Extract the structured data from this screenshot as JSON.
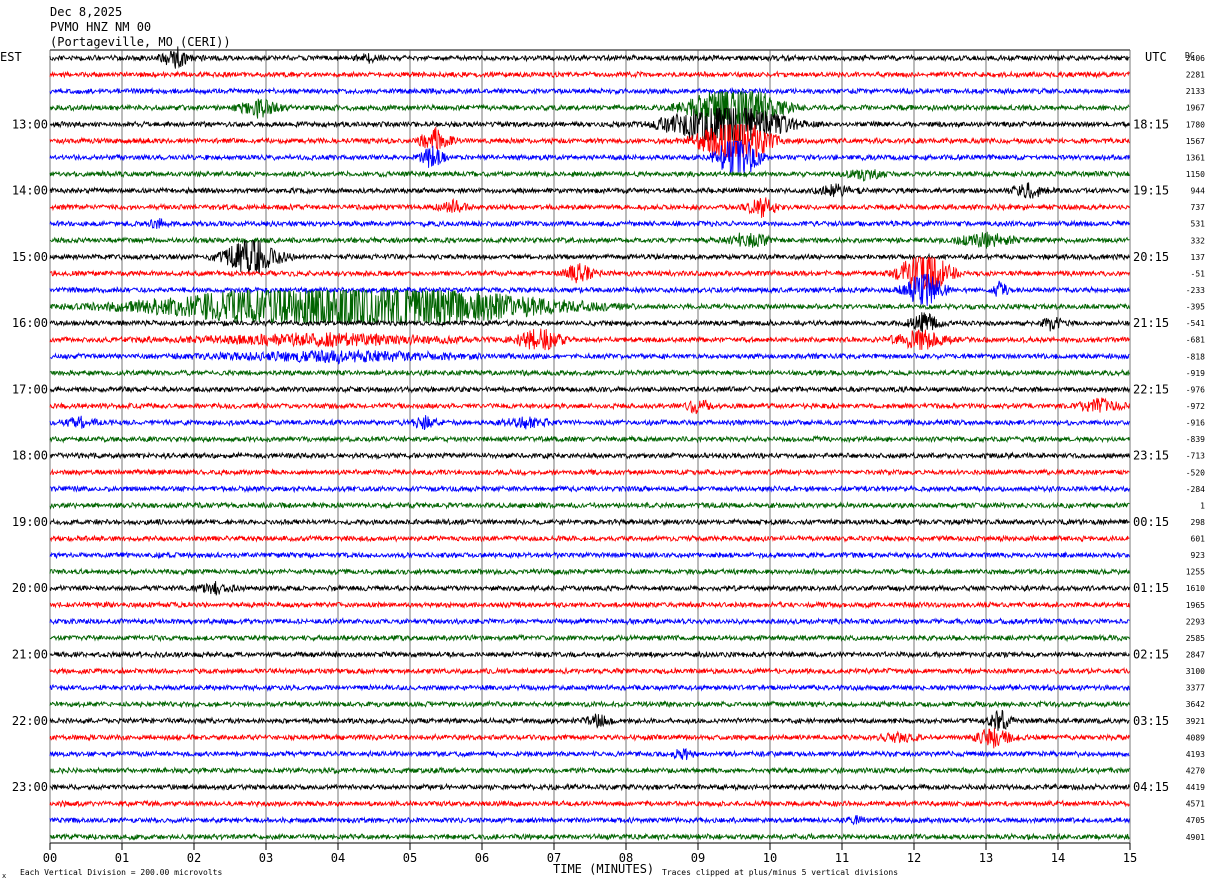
{
  "header": {
    "date": "Dec 8,2025",
    "station": "PVMO HNZ NM 00",
    "location": "(Portageville, MO (CERI))"
  },
  "labels": {
    "left_tz": "EST",
    "right_tz": "UTC",
    "dc": "DC",
    "x_axis": "TIME (MINUTES)",
    "scale_note": "Each Vertical Division =  200.00 microvolts",
    "clip_note": "Traces clipped at plus/minus 5 vertical divisions",
    "corner_mark": "x"
  },
  "chart_data": {
    "type": "line",
    "title": "PVMO HNZ NM 00",
    "xlabel": "TIME (MINUTES)",
    "xlim": [
      0,
      15
    ],
    "x_ticks": [
      "00",
      "01",
      "02",
      "03",
      "04",
      "05",
      "06",
      "07",
      "08",
      "09",
      "10",
      "11",
      "12",
      "13",
      "14",
      "15"
    ],
    "trace_count": 48,
    "trace_minutes": 15,
    "trace_colors": [
      "#000000",
      "#ff0000",
      "#0000ff",
      "#006400"
    ],
    "grid": "vertical lines each minute",
    "left_hour_labels": [
      "13:00",
      "14:00",
      "15:00",
      "16:00",
      "17:00",
      "18:00",
      "19:00",
      "20:00",
      "21:00",
      "22:00",
      "23:00"
    ],
    "right_hour_labels": [
      "18:15",
      "19:15",
      "20:15",
      "21:15",
      "22:15",
      "23:15",
      "00:15",
      "01:15",
      "02:15",
      "03:15",
      "04:15"
    ],
    "dc_offsets": [
      "2406",
      "2281",
      "2133",
      "1967",
      "1780",
      "1567",
      "1361",
      "1150",
      "944",
      "737",
      "531",
      "332",
      "137",
      "-51",
      "-233",
      "-395",
      "-541",
      "-681",
      "-818",
      "-919",
      "-976",
      "-972",
      "-916",
      "-839",
      "-713",
      "-520",
      "-284",
      "1",
      "298",
      "601",
      "923",
      "1255",
      "1610",
      "1965",
      "2293",
      "2585",
      "2847",
      "3100",
      "3377",
      "3642",
      "3921",
      "4089",
      "4193",
      "4270",
      "4419",
      "4571",
      "4705",
      "4901"
    ],
    "events": [
      {
        "trace": 0,
        "minute": 1.75,
        "amp": 1.6,
        "dur": 0.35
      },
      {
        "trace": 0,
        "minute": 4.4,
        "amp": 0.6,
        "dur": 0.25
      },
      {
        "trace": 3,
        "minute": 2.9,
        "amp": 1.4,
        "dur": 0.5
      },
      {
        "trace": 4,
        "minute": 9.4,
        "amp": 5,
        "dur": 1.4
      },
      {
        "trace": 3,
        "minute": 9.5,
        "amp": 5,
        "dur": 1.1
      },
      {
        "trace": 5,
        "minute": 9.5,
        "amp": 5,
        "dur": 0.9
      },
      {
        "trace": 6,
        "minute": 9.55,
        "amp": 5,
        "dur": 0.5
      },
      {
        "trace": 5,
        "minute": 5.35,
        "amp": 1.8,
        "dur": 0.4
      },
      {
        "trace": 6,
        "minute": 5.3,
        "amp": 1.5,
        "dur": 0.35
      },
      {
        "trace": 7,
        "minute": 11.3,
        "amp": 0.8,
        "dur": 0.5
      },
      {
        "trace": 8,
        "minute": 10.9,
        "amp": 0.9,
        "dur": 0.5
      },
      {
        "trace": 8,
        "minute": 13.6,
        "amp": 1.0,
        "dur": 0.5
      },
      {
        "trace": 9,
        "minute": 9.9,
        "amp": 1.5,
        "dur": 0.4
      },
      {
        "trace": 9,
        "minute": 5.6,
        "amp": 0.8,
        "dur": 0.4
      },
      {
        "trace": 10,
        "minute": 1.5,
        "amp": 0.7,
        "dur": 0.3
      },
      {
        "trace": 11,
        "minute": 9.7,
        "amp": 1.2,
        "dur": 0.6
      },
      {
        "trace": 11,
        "minute": 13.0,
        "amp": 1.0,
        "dur": 0.8
      },
      {
        "trace": 12,
        "minute": 2.8,
        "amp": 3.5,
        "dur": 0.7
      },
      {
        "trace": 13,
        "minute": 12.15,
        "amp": 5,
        "dur": 0.6
      },
      {
        "trace": 13,
        "minute": 7.35,
        "amp": 1.4,
        "dur": 0.4
      },
      {
        "trace": 14,
        "minute": 12.15,
        "amp": 3,
        "dur": 0.5
      },
      {
        "trace": 14,
        "minute": 13.2,
        "amp": 1.3,
        "dur": 0.2
      },
      {
        "trace": 15,
        "minute": 4.2,
        "amp": 5,
        "dur": 4.6
      },
      {
        "trace": 16,
        "minute": 12.15,
        "amp": 1.5,
        "dur": 0.4
      },
      {
        "trace": 16,
        "minute": 13.9,
        "amp": 1.0,
        "dur": 0.3
      },
      {
        "trace": 17,
        "minute": 6.8,
        "amp": 1.8,
        "dur": 0.6
      },
      {
        "trace": 17,
        "minute": 12.1,
        "amp": 1.5,
        "dur": 0.7
      },
      {
        "trace": 17,
        "minute": 3.8,
        "amp": 0.8,
        "dur": 3.5
      },
      {
        "trace": 18,
        "minute": 4.0,
        "amp": 0.7,
        "dur": 3.5
      },
      {
        "trace": 21,
        "minute": 9.0,
        "amp": 1.1,
        "dur": 0.3
      },
      {
        "trace": 21,
        "minute": 14.6,
        "amp": 1.0,
        "dur": 0.6
      },
      {
        "trace": 22,
        "minute": 5.2,
        "amp": 1.0,
        "dur": 0.4
      },
      {
        "trace": 22,
        "minute": 6.6,
        "amp": 0.8,
        "dur": 0.6
      },
      {
        "trace": 22,
        "minute": 0.4,
        "amp": 0.7,
        "dur": 0.5
      },
      {
        "trace": 32,
        "minute": 2.3,
        "amp": 0.7,
        "dur": 0.5
      },
      {
        "trace": 40,
        "minute": 7.6,
        "amp": 0.8,
        "dur": 0.4
      },
      {
        "trace": 40,
        "minute": 13.2,
        "amp": 1.6,
        "dur": 0.3
      },
      {
        "trace": 41,
        "minute": 13.1,
        "amp": 1.4,
        "dur": 0.5
      },
      {
        "trace": 41,
        "minute": 11.8,
        "amp": 0.7,
        "dur": 0.5
      },
      {
        "trace": 42,
        "minute": 8.8,
        "amp": 0.7,
        "dur": 0.3
      },
      {
        "trace": 46,
        "minute": 11.2,
        "amp": 0.6,
        "dur": 0.2
      }
    ]
  }
}
